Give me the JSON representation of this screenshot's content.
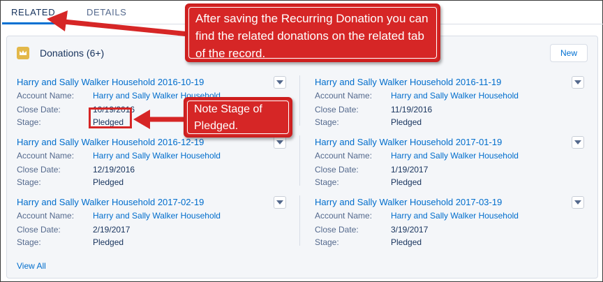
{
  "tabs": [
    {
      "label": "RELATED",
      "active": true
    },
    {
      "label": "DETAILS",
      "active": false
    }
  ],
  "card": {
    "title": "Donations (6+)",
    "icon": "crown-icon",
    "icon_color": "#e3b84a",
    "new_button": "New",
    "view_all": "View All"
  },
  "labels": {
    "account": "Account Name:",
    "close": "Close Date:",
    "stage": "Stage:"
  },
  "records": [
    {
      "title": "Harry and Sally Walker Household 2016-10-19",
      "account": "Harry and Sally Walker Household",
      "close_date": "10/19/2016",
      "stage": "Pledged"
    },
    {
      "title": "Harry and Sally Walker Household 2016-11-19",
      "account": "Harry and Sally Walker Household",
      "close_date": "11/19/2016",
      "stage": "Pledged"
    },
    {
      "title": "Harry and Sally Walker Household 2016-12-19",
      "account": "Harry and Sally Walker Household",
      "close_date": "12/19/2016",
      "stage": "Pledged"
    },
    {
      "title": "Harry and Sally Walker Household 2017-01-19",
      "account": "Harry and Sally Walker Household",
      "close_date": "1/19/2017",
      "stage": "Pledged"
    },
    {
      "title": "Harry and Sally Walker Household 2017-02-19",
      "account": "Harry and Sally Walker Household",
      "close_date": "2/19/2017",
      "stage": "Pledged"
    },
    {
      "title": "Harry and Sally Walker Household 2017-03-19",
      "account": "Harry and Sally Walker Household",
      "close_date": "3/19/2017",
      "stage": "Pledged"
    }
  ],
  "callouts": {
    "main": "After saving the Recurring Donation you can find the related donations on the related tab of the record.",
    "stage": "Note Stage of Pledged."
  },
  "colors": {
    "accent": "#0070d2",
    "callout": "#d62626",
    "link": "#006dcc"
  }
}
